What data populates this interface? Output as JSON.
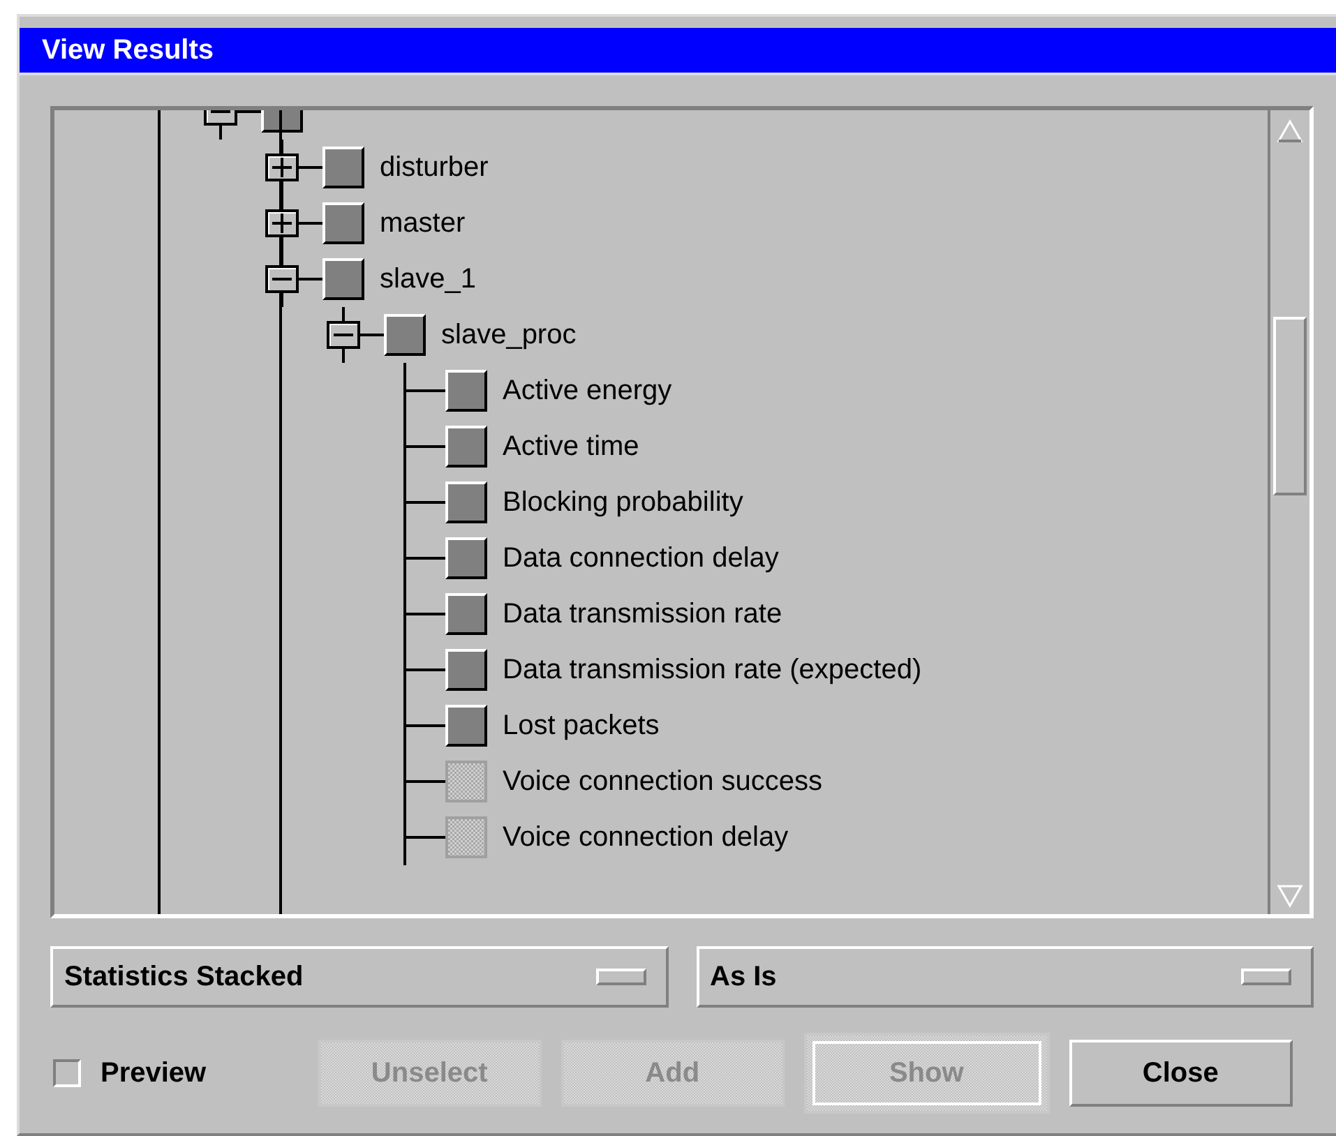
{
  "window": {
    "title": "View Results"
  },
  "tree": [
    {
      "kind": "group",
      "expanded": true,
      "available": true,
      "children": [
        {
          "label": "disturber",
          "kind": "group",
          "expanded": false,
          "available": true
        },
        {
          "label": "master",
          "kind": "group",
          "expanded": false,
          "available": true
        },
        {
          "label": "slave_1",
          "kind": "group",
          "expanded": true,
          "available": true,
          "children": [
            {
              "label": "slave_proc",
              "kind": "group",
              "expanded": true,
              "available": true,
              "children": [
                {
                  "label": "Active energy",
                  "kind": "leaf",
                  "available": true
                },
                {
                  "label": "Active time",
                  "kind": "leaf",
                  "available": true
                },
                {
                  "label": "Blocking probability",
                  "kind": "leaf",
                  "available": true
                },
                {
                  "label": "Data connection delay",
                  "kind": "leaf",
                  "available": true
                },
                {
                  "label": "Data transmission rate",
                  "kind": "leaf",
                  "available": true
                },
                {
                  "label": "Data transmission rate (expected)",
                  "kind": "leaf",
                  "available": true
                },
                {
                  "label": "Lost packets",
                  "kind": "leaf",
                  "available": true
                },
                {
                  "label": "Voice connection success",
                  "kind": "leaf",
                  "available": false
                },
                {
                  "label": "Voice connection delay",
                  "kind": "leaf",
                  "available": false
                }
              ]
            }
          ]
        }
      ]
    }
  ],
  "dropdowns": [
    {
      "value": "Statistics Stacked"
    },
    {
      "value": "As Is"
    }
  ],
  "preview": {
    "label": "Preview",
    "checked": false
  },
  "buttons": [
    {
      "label": "Unselect",
      "disabled": true,
      "default": false
    },
    {
      "label": "Add",
      "disabled": true,
      "default": false
    },
    {
      "label": "Show",
      "disabled": true,
      "default": true
    },
    {
      "label": "Close",
      "disabled": false,
      "default": false
    }
  ]
}
